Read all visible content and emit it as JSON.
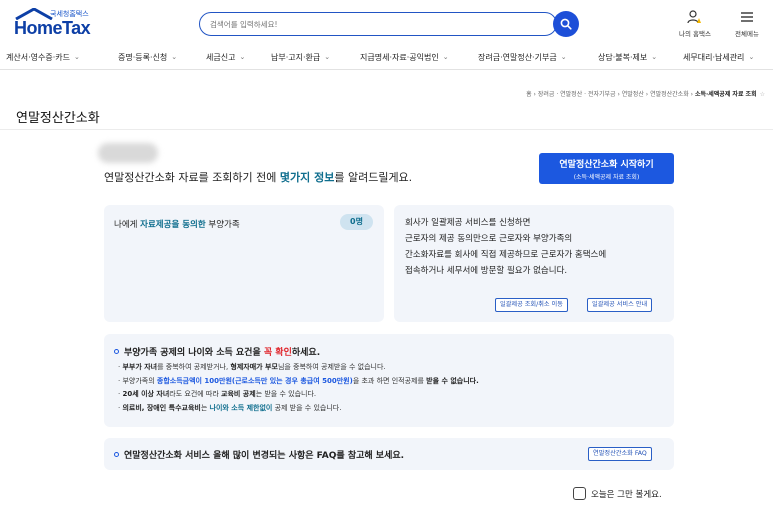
{
  "header": {
    "logo_sub": "국세청홈택스",
    "logo_main": "HomeTax",
    "search": {
      "placeholder": "검색어를 입력하세요!"
    },
    "my_hometax_label": "나의 홈택스",
    "menu_label": "전체메뉴"
  },
  "nav": {
    "items": [
      "계산서·영수증·카드",
      "증명·등록·신청",
      "세금신고",
      "납부·고지·환급",
      "지급명세·자료·공익법인",
      "장려금·연말정산·기부금",
      "상담·불복·제보",
      "세무대리·납세관리"
    ]
  },
  "breadcrumb": {
    "items": [
      "홈",
      "장려금 · 연말정산 · 전자기부금",
      "연말정산",
      "연말정산간소화"
    ],
    "current": "소득·세액공제 자료 조회"
  },
  "page": {
    "title": "연말정산간소화",
    "intro_pre": "연말정산간소화 자료를 조회하기 전에 ",
    "intro_hl": "몇가지 정보",
    "intro_post": "를 알려드릴게요.",
    "start_button": {
      "line1": "연말정산간소화 시작하기",
      "line2": "(소득·세액공제 자료 조회)"
    }
  },
  "consent_panel": {
    "pre": "나에게 ",
    "hl": "자료제공을 동의한",
    "post": " 부양가족",
    "count": "0명"
  },
  "bulk_panel": {
    "lines": [
      "회사가 일괄제공 서비스를 신청하면",
      "근로자의 제공 동의만으로 근로자와 부양가족의",
      "간소화자료를 회사에 직접 제공하므로 근로자가 홈택스에",
      "접속하거나 세무서에 방문할 필요가 없습니다."
    ],
    "btn_query": "일괄제공 조회/취소 이동",
    "btn_guide": "일괄제공 서비스 안내"
  },
  "requirements": {
    "title_pre": "부양가족 공제의 나이와 소득 요건을 ",
    "title_red": "꼭 확인",
    "title_post": "하세요.",
    "r1": {
      "a": "부부가 자녀",
      "b": "를 중복하여 공제받거나, ",
      "c": "형제자매가 부모",
      "d": "님을 중복하여 공제받을 수 없습니다."
    },
    "r2": {
      "a": "부양가족의 ",
      "b": "종합소득금액이 100만원(근로소득만 있는 경우 총급여 500만원)",
      "c": "을 초과 하면 인적공제를 ",
      "d": "받을 수 없습니다."
    },
    "r3": {
      "a": "20세 이상 자녀",
      "b": "라도 요건에 따라 ",
      "c": "교육비 공제",
      "d": "는 받을 수 있습니다."
    },
    "r4": {
      "a": "의료비, 장애인 특수교육비",
      "b": "는 ",
      "c": "나이와 소득 제한없이",
      "d": " 공제 받을 수 있습니다."
    }
  },
  "faq": {
    "text": "연말정산간소화 서비스 올해 많이 변경되는 사항은 FAQ를 참고해 보세요.",
    "button": "연말정산간소화 FAQ"
  },
  "footer": {
    "dismiss_label": "오늘은 그만 볼게요."
  },
  "colors": {
    "primary": "#1c58e0",
    "accent_teal": "#0f6e8e",
    "warning_red": "#e0262c",
    "panel_bg": "#f2f5fa"
  }
}
